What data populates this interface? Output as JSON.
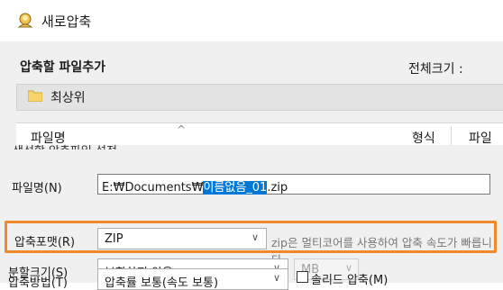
{
  "window": {
    "title": "새로압축"
  },
  "background_dialog": {
    "section_title": "압축할 파일추가",
    "total_size_label": "전체크기 :",
    "path": "최상위",
    "columns": [
      "파일명",
      "형식",
      "파일"
    ]
  },
  "main_dialog": {
    "cut_section_title": "생성할 압축파일 설정",
    "filename": {
      "label": "파일명(N)",
      "prefix": "E:₩Documents₩",
      "selected": "이름없음_01",
      "suffix": ".zip"
    },
    "format": {
      "label": "압축포맷(R)",
      "value": "ZIP",
      "hint": "zip은 멀티코어를 사용하여 압축 속도가 빠릅니다."
    },
    "split": {
      "label": "분할크기(S)",
      "value": "분할하지 않음",
      "unit": "MB"
    },
    "method": {
      "label": "압축방법(T)",
      "value": "압축률 보통(속도 보통)",
      "solid_label": "솔리드 압축(M)"
    }
  },
  "colors": {
    "highlight": "#f0892a",
    "selection": "#0078d7"
  }
}
